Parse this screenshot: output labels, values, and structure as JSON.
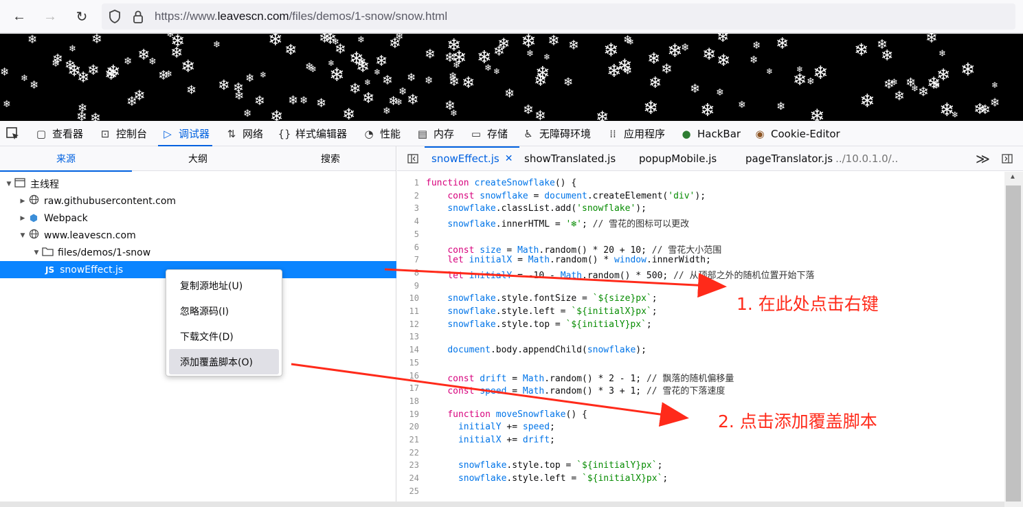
{
  "browser": {
    "url_prefix": "https://www.",
    "url_domain": "leavescn.com",
    "url_path": "/files/demos/1-snow/snow.html",
    "back_icon": "←",
    "forward_icon": "→",
    "reload_icon": "↻",
    "shield_icon": "⛉",
    "lock_icon": "🔒"
  },
  "snow_glyph": "❄",
  "devtools": {
    "tabs": [
      {
        "icon": "⛶",
        "label": ""
      },
      {
        "icon": "▢",
        "label": "查看器"
      },
      {
        "icon": "⊡",
        "label": "控制台"
      },
      {
        "icon": "▷",
        "label": "调试器"
      },
      {
        "icon": "⇅",
        "label": "网络"
      },
      {
        "icon": "{}",
        "label": "样式编辑器"
      },
      {
        "icon": "◔",
        "label": "性能"
      },
      {
        "icon": "▤",
        "label": "内存"
      },
      {
        "icon": "▭",
        "label": "存储"
      },
      {
        "icon": "♿",
        "label": "无障碍环境"
      },
      {
        "icon": "⁞⁞",
        "label": "应用程序"
      },
      {
        "icon": "●",
        "label": "HackBar"
      },
      {
        "icon": "◉",
        "label": "Cookie-Editor"
      }
    ],
    "left_tabs": [
      "来源",
      "大纲",
      "搜索"
    ],
    "tree": [
      {
        "label": "主线程",
        "level": 0,
        "twisty": "▼",
        "icon": "▭"
      },
      {
        "label": "raw.githubusercontent.com",
        "level": 1,
        "twisty": "▶",
        "icon": "⊕"
      },
      {
        "label": "Webpack",
        "level": 1,
        "twisty": "▶",
        "icon": "⬢"
      },
      {
        "label": "www.leavescn.com",
        "level": 1,
        "twisty": "▼",
        "icon": "⊕"
      },
      {
        "label": "files/demos/1-snow",
        "level": 2,
        "twisty": "▼",
        "icon": "▭"
      },
      {
        "label": "snowEffect.js",
        "level": 3,
        "twisty": "",
        "icon": "JS"
      }
    ],
    "context_menu": [
      "复制源地址(U)",
      "忽略源码(I)",
      "下载文件(D)",
      "添加覆盖脚本(O)"
    ],
    "editor_tabs": [
      {
        "label": "snowEffect.js",
        "close": "✕"
      },
      {
        "label": "showTranslated.js"
      },
      {
        "label": "popupMobile.js"
      },
      {
        "label": "pageTranslator.js",
        "suffix": "../10.0.1.0/.."
      }
    ],
    "more_tabs_icon": "≫",
    "toggle_left_icon": "◧",
    "toggle_right_icon": "◨",
    "code_lines": [
      {
        "n": "1",
        "t": "function createSnowflake() {"
      },
      {
        "n": "2",
        "t": "    const snowflake = document.createElement('div');"
      },
      {
        "n": "3",
        "t": "    snowflake.classList.add('snowflake');"
      },
      {
        "n": "4",
        "t": "    snowflake.innerHTML = '❄'; // 雪花的图标可以更改"
      },
      {
        "n": "5",
        "t": ""
      },
      {
        "n": "6",
        "t": "    const size = Math.random() * 20 + 10; // 雪花大小范围"
      },
      {
        "n": "7",
        "t": "    let initialX = Math.random() * window.innerWidth;"
      },
      {
        "n": "8",
        "t": "    let initialY = -10 - Math.random() * 500; // 从顶部之外的随机位置开始下落"
      },
      {
        "n": "9",
        "t": ""
      },
      {
        "n": "10",
        "t": "    snowflake.style.fontSize = `${size}px`;"
      },
      {
        "n": "11",
        "t": "    snowflake.style.left = `${initialX}px`;"
      },
      {
        "n": "12",
        "t": "    snowflake.style.top = `${initialY}px`;"
      },
      {
        "n": "13",
        "t": ""
      },
      {
        "n": "14",
        "t": "    document.body.appendChild(snowflake);"
      },
      {
        "n": "15",
        "t": ""
      },
      {
        "n": "16",
        "t": "    const drift = Math.random() * 2 - 1; // 飘落的随机偏移量"
      },
      {
        "n": "17",
        "t": "    const speed = Math.random() * 3 + 1; // 雪花的下落速度"
      },
      {
        "n": "18",
        "t": ""
      },
      {
        "n": "19",
        "t": "    function moveSnowflake() {"
      },
      {
        "n": "20",
        "t": "      initialY += speed;"
      },
      {
        "n": "21",
        "t": "      initialX += drift;"
      },
      {
        "n": "22",
        "t": ""
      },
      {
        "n": "23",
        "t": "      snowflake.style.top = `${initialY}px`;"
      },
      {
        "n": "24",
        "t": "      snowflake.style.left = `${initialX}px`;"
      },
      {
        "n": "25",
        "t": ""
      }
    ]
  },
  "annotations": {
    "step1": "1. 在此处点击右键",
    "step2": "2. 点击添加覆盖脚本",
    "color": "#ff2a1a"
  }
}
